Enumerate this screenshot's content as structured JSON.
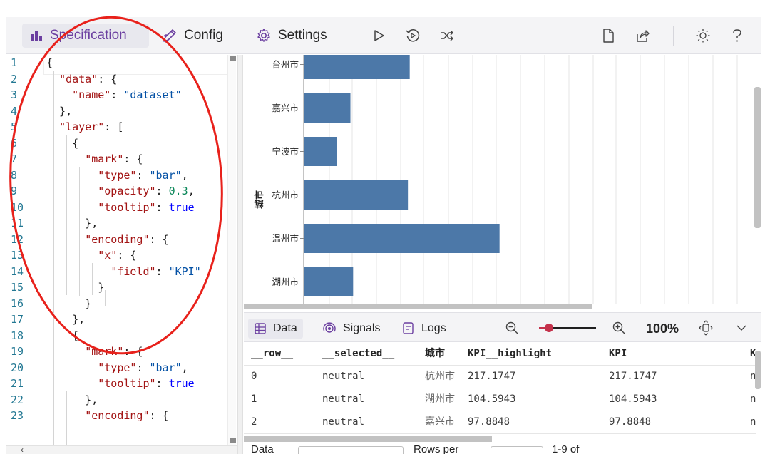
{
  "toolbar": {
    "tabs": {
      "specification": "Specification",
      "config": "Config",
      "settings": "Settings"
    }
  },
  "editor": {
    "line_numbers": [
      "1",
      "2",
      "3",
      "4",
      "5",
      "6",
      "7",
      "8",
      "9",
      "10",
      "11",
      "12",
      "13",
      "14",
      "15",
      "16",
      "17",
      "18",
      "19",
      "20",
      "21",
      "22",
      "23"
    ],
    "lines": [
      "{",
      "  \"data\": {",
      "    \"name\": \"dataset\"",
      "  },",
      "  \"layer\": [",
      "    {",
      "      \"mark\": {",
      "        \"type\": \"bar\",",
      "        \"opacity\": 0.3,",
      "        \"tooltip\": true",
      "      },",
      "      \"encoding\": {",
      "        \"x\": {",
      "          \"field\": \"KPI\"",
      "        }",
      "      }",
      "    },",
      "    {",
      "      \"mark\": {",
      "        \"type\": \"bar\",",
      "        \"tooltip\": true",
      "      },",
      "      \"encoding\": {"
    ]
  },
  "chart_data": {
    "type": "bar",
    "orientation": "horizontal",
    "ylabel": "城市",
    "categories": [
      "台州市",
      "嘉兴市",
      "宁波市",
      "杭州市",
      "温州市",
      "湖州市"
    ],
    "values": [
      118,
      52,
      37,
      116,
      218,
      55
    ],
    "series_color": "#4c78a8",
    "grid": true,
    "note_partial_view": "x-axis not visible in viewport"
  },
  "data_panel": {
    "tabs": {
      "data": "Data",
      "signals": "Signals",
      "logs": "Logs"
    },
    "zoom": "100%",
    "columns": [
      "__row__",
      "__selected__",
      "城市",
      "KPI__highlight",
      "KPI",
      "K"
    ],
    "rows": [
      [
        "0",
        "neutral",
        "杭州市",
        "217.1747",
        "217.1747",
        "n"
      ],
      [
        "1",
        "neutral",
        "湖州市",
        "104.5943",
        "104.5943",
        "n"
      ],
      [
        "2",
        "neutral",
        "嘉兴市",
        "97.8848",
        "97.8848",
        "n"
      ]
    ],
    "footer": {
      "data_label": "Data",
      "rows_per_label": "Rows per",
      "range_label": "1-9 of"
    }
  },
  "colors": {
    "accent": "#6b3fa0",
    "bar": "#4c78a8",
    "annotation": "#e8211b"
  }
}
